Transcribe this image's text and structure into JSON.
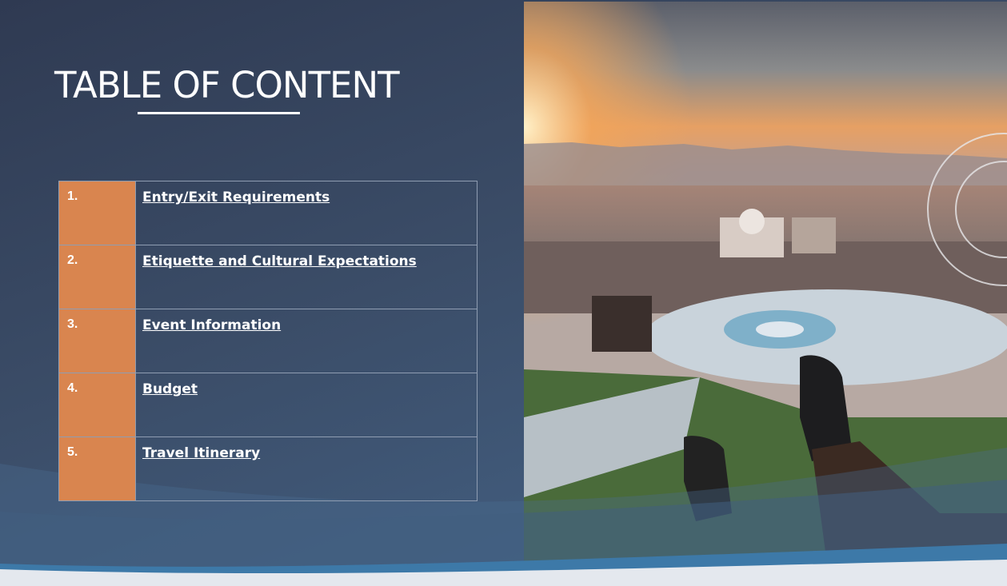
{
  "title": "TABLE OF CONTENT",
  "toc": [
    {
      "number": "1.",
      "label": "Entry/Exit Requirements"
    },
    {
      "number": "2.",
      "label": "Etiquette and Cultural Expectations"
    },
    {
      "number": "3.",
      "label": "Event Information"
    },
    {
      "number": "4.",
      "label": "Budget"
    },
    {
      "number": "5.",
      "label": "Travel Itinerary"
    }
  ],
  "colors": {
    "accent": "#d9854f",
    "background": "#3b4d68",
    "text": "#ffffff"
  }
}
